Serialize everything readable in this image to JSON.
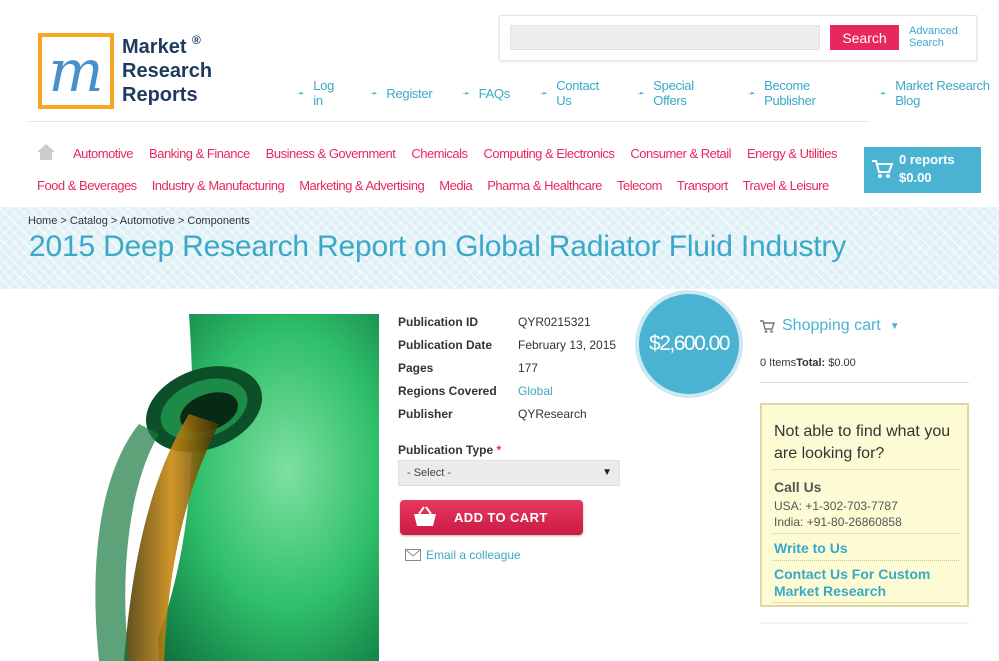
{
  "logo": {
    "line1": "Market",
    "line2": "Research",
    "line3": "Reports",
    "reg": "®",
    "letter": "m"
  },
  "search": {
    "placeholder": "",
    "button": "Search",
    "advanced_line1": "Advanced",
    "advanced_line2": "Search"
  },
  "top_links": [
    "Log in",
    "Register",
    "FAQs",
    "Contact Us",
    "Special Offers",
    "Become Publisher",
    "Market Research Blog"
  ],
  "categories_row1": [
    "Automotive",
    "Banking & Finance",
    "Business & Government",
    "Chemicals",
    "Computing & Electronics",
    "Consumer & Retail",
    "Energy & Utilities"
  ],
  "categories_row2": [
    "Food & Beverages",
    "Industry & Manufacturing",
    "Marketing & Advertising",
    "Media",
    "Pharma & Healthcare",
    "Telecom",
    "Transport",
    "Travel & Leisure"
  ],
  "cart": {
    "count": "0 reports",
    "total": "$0.00"
  },
  "breadcrumb": [
    "Home",
    "Catalog",
    "Automotive",
    "Components"
  ],
  "breadcrumb_sep": ">",
  "title": "2015 Deep Research Report on Global Radiator Fluid Industry",
  "details": {
    "id_label": "Publication ID",
    "id_value": "QYR0215321",
    "date_label": "Publication Date",
    "date_value": "February 13, 2015",
    "pages_label": "Pages",
    "pages_value": "177",
    "regions_label": "Regions Covered",
    "regions_value": "Global",
    "publisher_label": "Publisher",
    "publisher_value": "QYResearch"
  },
  "price": "$2,600.00",
  "publication_type": {
    "label": "Publication Type",
    "required": "*",
    "selected": "- Select -"
  },
  "add_to_cart": "ADD TO CART",
  "email_colleague": "Email a colleague",
  "sidebar": {
    "cart_title": "Shopping cart",
    "items": "0 Items",
    "total_label": "Total:",
    "total_value": "$0.00",
    "help_question": "Not able to find what you are looking for?",
    "call_us": "Call Us",
    "usa_phone": "USA: +1-302-703-7787",
    "india_phone": "India: +91-80-26860858",
    "write_to_us": "Write to Us",
    "custom_research": "Contact Us For Custom Market Research"
  },
  "colors": {
    "accent_blue": "#3aa8c7",
    "accent_pink": "#e8285c",
    "cart_blue": "#4ab3d1",
    "logo_orange": "#f5a623"
  }
}
